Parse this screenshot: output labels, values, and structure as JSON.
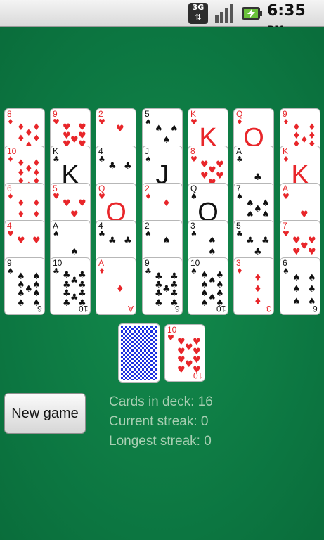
{
  "status_bar": {
    "network": "3G",
    "time": "6:35",
    "ampm": "PM",
    "icons": [
      "3g-data-icon",
      "signal-icon",
      "battery-charging-icon"
    ]
  },
  "colors": {
    "felt": "#0d7a43",
    "red": "#e8262a",
    "black": "#111111",
    "stats_text": "#a9cfb3",
    "card_back": "#1b2fe0"
  },
  "tableau": [
    [
      {
        "rank": "8",
        "suit": "♦"
      },
      {
        "rank": "10",
        "suit": "♦"
      },
      {
        "rank": "6",
        "suit": "♦"
      },
      {
        "rank": "4",
        "suit": "♥"
      },
      {
        "rank": "9",
        "suit": "♠",
        "bottom": "6"
      }
    ],
    [
      {
        "rank": "9",
        "suit": "♥"
      },
      {
        "rank": "K",
        "suit": "♣",
        "face": "K"
      },
      {
        "rank": "5",
        "suit": "♥"
      },
      {
        "rank": "A",
        "suit": "♠"
      },
      {
        "rank": "10",
        "suit": "♣",
        "bottom": "10"
      }
    ],
    [
      {
        "rank": "2",
        "suit": "♥"
      },
      {
        "rank": "4",
        "suit": "♣"
      },
      {
        "rank": "Q",
        "suit": "♥",
        "face": "Q"
      },
      {
        "rank": "4",
        "suit": "♣"
      },
      {
        "rank": "A",
        "suit": "♦",
        "bottom": "A"
      }
    ],
    [
      {
        "rank": "5",
        "suit": "♠"
      },
      {
        "rank": "J",
        "suit": "♠",
        "face": "J"
      },
      {
        "rank": "2",
        "suit": "♦"
      },
      {
        "rank": "2",
        "suit": "♠"
      },
      {
        "rank": "9",
        "suit": "♣",
        "bottom": "6"
      }
    ],
    [
      {
        "rank": "K",
        "suit": "♥",
        "face": "K"
      },
      {
        "rank": "8",
        "suit": "♥"
      },
      {
        "rank": "Q",
        "suit": "♠",
        "face": "Q"
      },
      {
        "rank": "3",
        "suit": "♠"
      },
      {
        "rank": "10",
        "suit": "♠",
        "bottom": "10"
      }
    ],
    [
      {
        "rank": "Q",
        "suit": "♦",
        "face": "Q"
      },
      {
        "rank": "A",
        "suit": "♣"
      },
      {
        "rank": "7",
        "suit": "♠"
      },
      {
        "rank": "5",
        "suit": "♣"
      },
      {
        "rank": "3",
        "suit": "♦",
        "bottom": "3"
      }
    ],
    [
      {
        "rank": "9",
        "suit": "♦"
      },
      {
        "rank": "K",
        "suit": "♦",
        "face": "K"
      },
      {
        "rank": "A",
        "suit": "♥"
      },
      {
        "rank": "7",
        "suit": "♥"
      },
      {
        "rank": "6",
        "suit": "♠",
        "bottom": "6"
      }
    ]
  ],
  "waste": {
    "rank": "10",
    "suit": "♥",
    "bottom": "10"
  },
  "controls": {
    "new_game_label": "New game"
  },
  "stats": {
    "cards_in_deck": "Cards in deck: 16",
    "current_streak": "Current streak: 0",
    "longest_streak": "Longest streak: 0"
  }
}
